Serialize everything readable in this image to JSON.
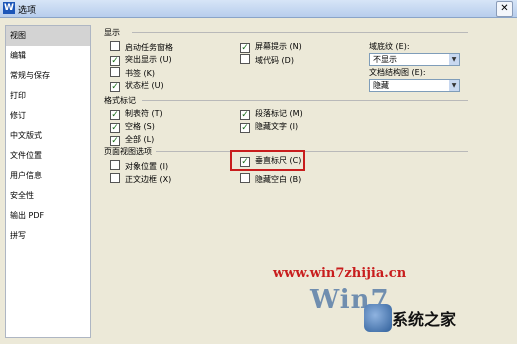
{
  "window": {
    "app_icon_letter": "W",
    "title": "选项",
    "close_glyph": "✕"
  },
  "sidebar": {
    "items": [
      {
        "label": "视图",
        "active": true
      },
      {
        "label": "编辑"
      },
      {
        "label": "常规与保存"
      },
      {
        "label": "打印"
      },
      {
        "label": "修订"
      },
      {
        "label": "中文版式"
      },
      {
        "label": "文件位置"
      },
      {
        "label": "用户信息"
      },
      {
        "label": "安全性"
      },
      {
        "label": "输出 PDF"
      },
      {
        "label": "拼写"
      }
    ]
  },
  "display": {
    "title": "显示",
    "opt_taskpane": "启动任务窗格",
    "opt_highlight": "突出显示 (U)",
    "opt_bookmark": "书签 (K)",
    "opt_statusbar": "状态栏 (U)",
    "opt_screentip": "屏幕提示 (N)",
    "opt_fieldcode": "域代码 (D)",
    "shading_label": "域底纹 (E):",
    "shading_value": "不显示",
    "docmap_label": "文档结构图 (E):",
    "docmap_value": "隐藏"
  },
  "format": {
    "title": "格式标记",
    "opt_tab": "制表符 (T)",
    "opt_space": "空格 (S)",
    "opt_all": "全部 (L)",
    "opt_para": "段落标记 (M)",
    "opt_hidden": "隐藏文字 (I)"
  },
  "page": {
    "title": "页面视图选项",
    "opt_objpos": "对象位置 (I)",
    "opt_textbound": "正文边框 (X)",
    "opt_vruler": "垂直标尺 (C)",
    "opt_hidewhite": "隐藏空白 (B)"
  },
  "watermark": {
    "url": "www.win7zhijia.cn",
    "logo": "Win7",
    "brand": "系统之家"
  },
  "colors": {
    "highlight_box": "#c81d1d",
    "selected_sidebar": "#d3d3d3",
    "check": "#1a6e1a"
  }
}
